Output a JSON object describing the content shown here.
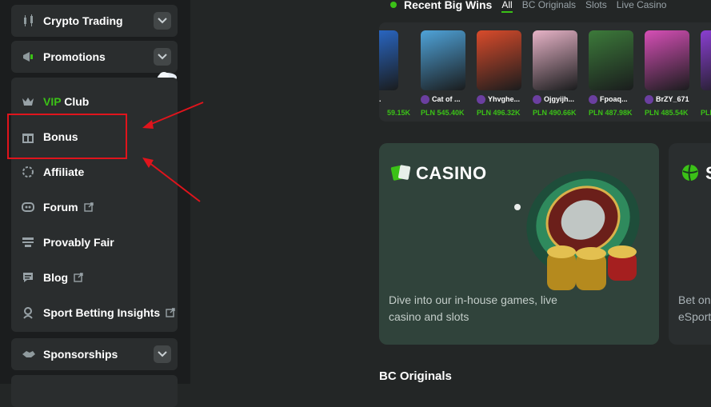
{
  "sidebar": {
    "crypto_trading": "Crypto Trading",
    "promotions": "Promotions",
    "items": [
      {
        "pre": "VIP",
        "label": " Club"
      },
      {
        "label": "Bonus"
      },
      {
        "label": "Affiliate"
      },
      {
        "label": "Forum"
      },
      {
        "label": "Provably Fair"
      },
      {
        "label": "Blog"
      },
      {
        "label": "Sport Betting Insights"
      }
    ],
    "sponsorships": "Sponsorships"
  },
  "recent_wins": {
    "title": "Recent Big Wins",
    "tabs": [
      "All",
      "BC Originals",
      "Slots",
      "Live Casino"
    ],
    "entries": [
      {
        "player": "jch...",
        "amount": "59.15K",
        "color": "#2b6fd6"
      },
      {
        "player": "Cat of ...",
        "amount": "PLN 545.40K",
        "color": "#4fa3d9"
      },
      {
        "player": "Yhvghe...",
        "amount": "PLN 496.32K",
        "color": "#d94b2b"
      },
      {
        "player": "Ojgyijh...",
        "amount": "PLN 490.66K",
        "color": "#e7b3c7"
      },
      {
        "player": "Fpoaq...",
        "amount": "PLN 487.98K",
        "color": "#3c7a3a"
      },
      {
        "player": "BrZY_671",
        "amount": "PLN 485.54K",
        "color": "#d64fb6"
      },
      {
        "player": "",
        "amount": "PLN",
        "color": "#8a3fd1"
      }
    ]
  },
  "casino": {
    "title": "CASINO",
    "description": "Dive into our in-house games, live casino and slots"
  },
  "sports": {
    "title": "S",
    "description_line1": "Bet on",
    "description_line2": "eSport"
  },
  "section_heading": "BC Originals",
  "colors": {
    "accent": "#3bc117",
    "highlight": "#e0141c"
  }
}
